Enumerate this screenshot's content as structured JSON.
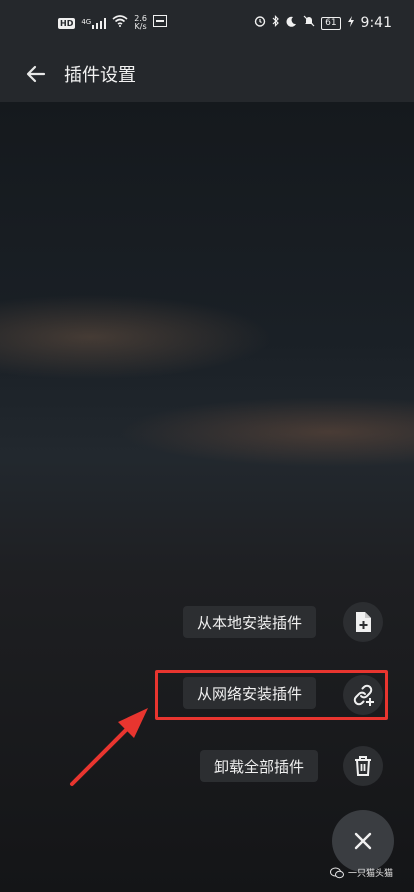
{
  "status_bar": {
    "left_badge": "HD",
    "net_type": "4G",
    "speed_value": "2.6",
    "speed_unit": "K/s",
    "battery": "61",
    "time": "9:41"
  },
  "app_bar": {
    "title": "插件设置"
  },
  "fab_menu": {
    "items": [
      {
        "label": "从本地安装插件",
        "icon": "file-plus-icon"
      },
      {
        "label": "从网络安装插件",
        "icon": "link-plus-icon"
      },
      {
        "label": "卸载全部插件",
        "icon": "trash-icon"
      }
    ],
    "close_icon": "close-icon"
  },
  "annotation": {
    "highlight_color": "#e8352f"
  },
  "watermark": {
    "text": "一只猫头猫"
  },
  "colors": {
    "bar": "#25282c",
    "chip": "#2c2e31",
    "fab": "#3a3d41"
  }
}
